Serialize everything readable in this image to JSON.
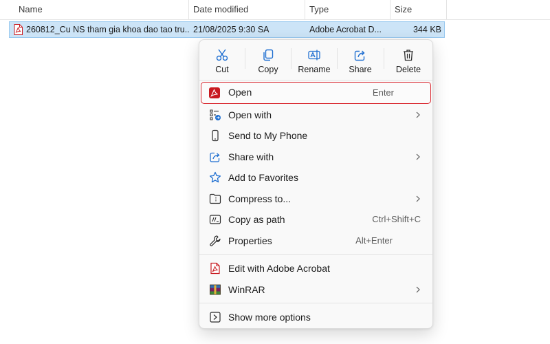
{
  "columns": {
    "name": "Name",
    "date_modified": "Date modified",
    "type": "Type",
    "size": "Size"
  },
  "file": {
    "name": "260812_Cu NS tham gia khoa dao tao tru...",
    "date_modified": "21/08/2025 9:30 SA",
    "type": "Adobe Acrobat D...",
    "size": "344 KB",
    "icon": "pdf-file-icon"
  },
  "context_menu": {
    "quick_actions": [
      {
        "label": "Cut",
        "icon": "scissors-icon"
      },
      {
        "label": "Copy",
        "icon": "copy-icon"
      },
      {
        "label": "Rename",
        "icon": "rename-icon"
      },
      {
        "label": "Share",
        "icon": "share-icon"
      },
      {
        "label": "Delete",
        "icon": "trash-icon"
      }
    ],
    "items": [
      {
        "label": "Open",
        "shortcut": "Enter",
        "icon": "adobe-pdf-icon",
        "highlighted": true
      },
      {
        "label": "Open with",
        "icon": "open-with-icon",
        "submenu": true
      },
      {
        "label": "Send to My Phone",
        "icon": "phone-icon"
      },
      {
        "label": "Share with",
        "icon": "share-with-icon",
        "submenu": true
      },
      {
        "label": "Add to Favorites",
        "icon": "star-icon"
      },
      {
        "label": "Compress to...",
        "icon": "zip-folder-icon",
        "submenu": true
      },
      {
        "label": "Copy as path",
        "shortcut": "Ctrl+Shift+C",
        "icon": "copy-path-icon"
      },
      {
        "label": "Properties",
        "shortcut": "Alt+Enter",
        "icon": "wrench-icon"
      },
      {
        "label": "Edit with Adobe Acrobat",
        "icon": "acrobat-edit-icon"
      },
      {
        "label": "WinRAR",
        "icon": "winrar-icon",
        "submenu": true
      },
      {
        "label": "Show more options",
        "icon": "show-more-icon"
      }
    ]
  },
  "colors": {
    "selection_bg": "#cce4f7",
    "selection_border": "#99c9ef",
    "highlight_border": "#d9262e",
    "accent_blue": "#1f6fd1",
    "adobe_red": "#c8191f"
  }
}
